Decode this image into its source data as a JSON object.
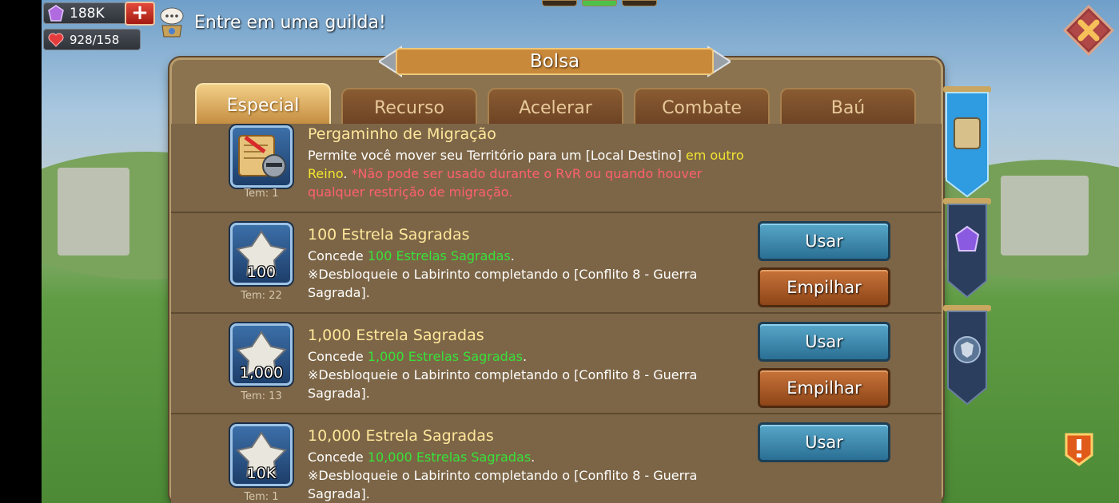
{
  "hud": {
    "gems": "188K",
    "stamina": "928/158",
    "plus_label": "+",
    "guild_prompt": "Entre em uma guilda!",
    "close_label": "✕"
  },
  "panel": {
    "title": "Bolsa",
    "tabs": [
      {
        "label": "Especial",
        "active": true
      },
      {
        "label": "Recurso",
        "active": false
      },
      {
        "label": "Acelerar",
        "active": false
      },
      {
        "label": "Combate",
        "active": false
      },
      {
        "label": "Baú",
        "active": false
      }
    ]
  },
  "items": [
    {
      "name": "Pergaminho de Migração",
      "have": "Tem: 1",
      "qty": "",
      "desc_a": "Permite você mover seu Território para um [Local Destino] ",
      "desc_b": "em outro Reino",
      "desc_c": ". ",
      "desc_d": "*Não pode ser usado durante o RvR ou quando houver qualquer restrição de migração."
    },
    {
      "name": "100 Estrela Sagradas",
      "have": "Tem: 22",
      "qty": "100",
      "grant_prefix": "Concede ",
      "grant_value": "100 Estrelas Sagradas",
      "grant_suffix": ".",
      "note": "※Desbloqueie o Labirinto completando o [Conflito 8 - Guerra Sagrada].",
      "use_label": "Usar",
      "stack_label": "Empilhar"
    },
    {
      "name": "1,000 Estrela Sagradas",
      "have": "Tem: 13",
      "qty": "1,000",
      "grant_prefix": "Concede ",
      "grant_value": "1,000 Estrelas Sagradas",
      "grant_suffix": ".",
      "note": "※Desbloqueie o Labirinto completando o [Conflito 8 - Guerra Sagrada].",
      "use_label": "Usar",
      "stack_label": "Empilhar"
    },
    {
      "name": "10,000 Estrela Sagradas",
      "have": "Tem: 1",
      "qty": "10K",
      "grant_prefix": "Concede ",
      "grant_value": "10,000 Estrelas Sagradas",
      "grant_suffix": ".",
      "note": "※Desbloqueie o Labirinto completando o [Conflito 8 - Guerra Sagrada].",
      "use_label": "Usar"
    }
  ],
  "side_tabs": [
    "scroll-map-icon",
    "gem-icon",
    "shield-icon"
  ],
  "colors": {
    "highlight_green": "#37e23a",
    "highlight_yellow": "#f2e630",
    "warning_red": "#ff5f72",
    "item_name": "#ffe79b",
    "use_button": "#3a86ae",
    "stack_button": "#a9582a"
  }
}
